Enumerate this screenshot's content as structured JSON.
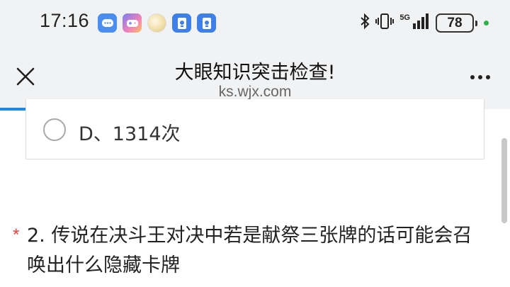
{
  "status_bar": {
    "time": "17:16",
    "network": "5G",
    "battery": "78",
    "notification_icons": [
      "chat-app-icon",
      "game-app-icon",
      "moon-app-icon",
      "card-app-icon",
      "card-app-icon"
    ]
  },
  "header": {
    "title": "大眼知识突击检查!",
    "domain": "ks.wjx.com"
  },
  "option": {
    "label": "D、1314次"
  },
  "question": {
    "required_mark": "*",
    "text": "2. 传说在决斗王对决中若是献祭三张牌的话可能会召唤出什么隐藏卡牌"
  },
  "colors": {
    "accent": "#1e88e5",
    "required": "#e64340",
    "status_bg": "#f1f2f3"
  }
}
